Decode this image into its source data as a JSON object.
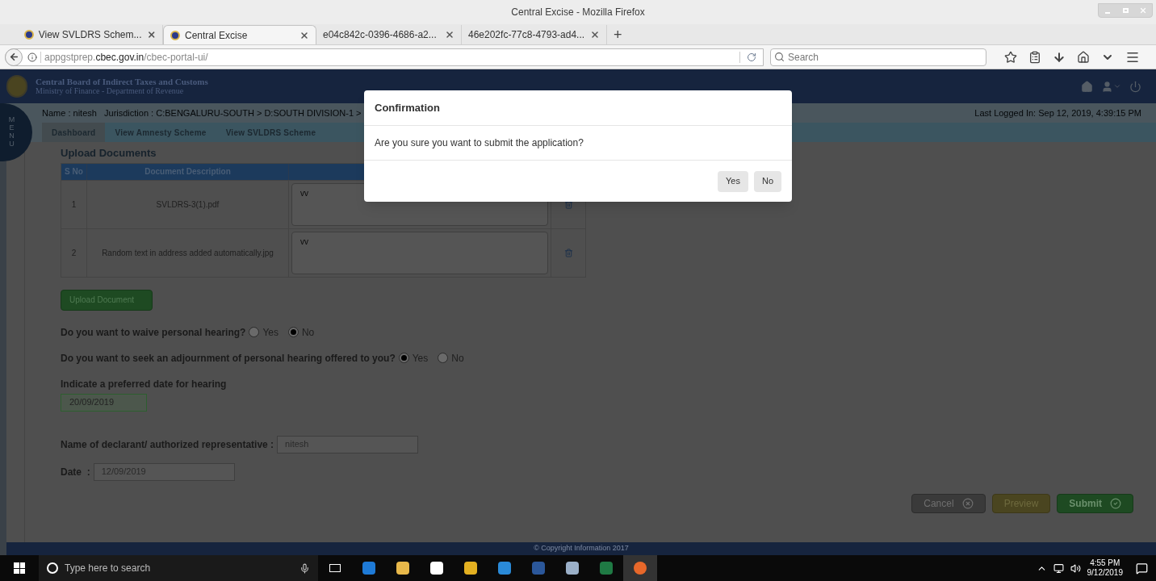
{
  "window": {
    "title": "Central Excise - Mozilla Firefox"
  },
  "browser": {
    "tabs": [
      {
        "label": "View SVLDRS Schem...",
        "selected": false,
        "favicon": true
      },
      {
        "label": "Central Excise",
        "selected": true,
        "favicon": true
      },
      {
        "label": "e04c842c-0396-4686-a2...",
        "selected": false,
        "favicon": false
      },
      {
        "label": "46e202fc-77c8-4793-ad4...",
        "selected": false,
        "favicon": false
      }
    ],
    "new_tab": "+",
    "address": {
      "prefix": "appgstprep.",
      "domain": "cbec.gov.in",
      "path": "/cbec-portal-ui/"
    },
    "search_placeholder": "Search"
  },
  "site": {
    "org": "Central Board of Indirect Taxes and Customs",
    "ministry": "Ministry of Finance - Department of Revenue",
    "menu_label": "MENU",
    "user_info": "Name : nitesh   Jurisdiction : C:BENGALURU-SOUTH > D:SOUTH DIVISION-1 >",
    "last_logged": "Last Logged In: Sep 12, 2019, 4:39:15 PM",
    "breadcrumbs": [
      "Dashboard",
      "View Amnesty Scheme",
      "View SVLDRS Scheme"
    ]
  },
  "upload": {
    "title": "Upload Documents",
    "columns": [
      "S No",
      "Document Description"
    ],
    "rows": [
      {
        "sno": "1",
        "description": "SVLDRS-3(1).pdf",
        "remark": "vv"
      },
      {
        "sno": "2",
        "description": "Random text in address added automatically.jpg",
        "remark": "vv"
      }
    ],
    "button": "Upload Document"
  },
  "questions": [
    {
      "text": "Do you want to waive personal hearing?",
      "options": [
        {
          "label": "Yes",
          "selected": false
        },
        {
          "label": "No",
          "selected": true
        }
      ]
    },
    {
      "text": "Do you want to seek an adjournment of personal hearing offered to you?",
      "options": [
        {
          "label": "Yes",
          "selected": true
        },
        {
          "label": "No",
          "selected": false
        }
      ]
    }
  ],
  "preferred_date": {
    "label": "Indicate a preferred date for hearing",
    "value": "20/09/2019"
  },
  "declarant": {
    "label": "Name of declarant/ authorized representative :",
    "value": "nitesh"
  },
  "date": {
    "label": "Date  :",
    "value": "12/09/2019"
  },
  "actions": [
    {
      "label": "Cancel",
      "kind": "cancel"
    },
    {
      "label": "Preview",
      "kind": "preview"
    },
    {
      "label": "Submit",
      "kind": "submit"
    }
  ],
  "footer": "© Copyright Information 2017",
  "dialog": {
    "title": "Confirmation",
    "message": "Are you sure you want to submit the application?",
    "buttons": [
      "Yes",
      "No"
    ]
  },
  "taskbar": {
    "search_placeholder": "Type here to search",
    "time": "4:55 PM",
    "date": "9/12/2019"
  }
}
